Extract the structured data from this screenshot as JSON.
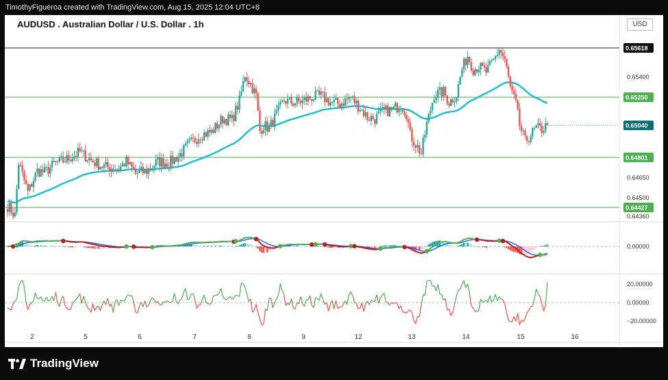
{
  "header": {
    "attribution": "TimothyFigueroa created with TradingView.com, Aug 15, 2025 12:04 UTC+8"
  },
  "chart_title": "AUDUSD . Australian Dollar / U.S. Dollar . 1h",
  "currency": "USD",
  "footer": {
    "logo_text": "TradingView"
  },
  "colors": {
    "bull": "#26a69a",
    "bear": "#ef5350",
    "ma": "#1fbdd2",
    "level": "#4caf50",
    "macd_fast": "#4caf50",
    "macd_slow": "#2962ff",
    "macd_signal": "#b71c1c",
    "osc": "#4caf50"
  },
  "chart_data": [
    {
      "type": "candlestick",
      "title": "AUDUSD . Australian Dollar / U.S. Dollar . 1h",
      "x_ticks": [
        "2",
        "5",
        "6",
        "7",
        "8",
        "9",
        "12",
        "13",
        "14",
        "15",
        "16"
      ],
      "ylim": [
        0.6432,
        0.6571
      ],
      "y_ticks": [
        0.654,
        0.6465,
        0.645,
        0.6436
      ],
      "horizontal_levels": [
        {
          "value": 0.65618,
          "label": "0.65618",
          "style": "black"
        },
        {
          "value": 0.6525,
          "label": "0.65250",
          "style": "green"
        },
        {
          "value": 0.64801,
          "label": "0.64801",
          "style": "green"
        },
        {
          "value": 0.64427,
          "label": "0.64427",
          "style": "green"
        }
      ],
      "last_price": {
        "value": 0.6504,
        "label": "0.65040"
      },
      "close_path": [
        [
          0,
          0.6444
        ],
        [
          4,
          0.6437
        ],
        [
          6,
          0.6476
        ],
        [
          11,
          0.6454
        ],
        [
          16,
          0.647
        ],
        [
          20,
          0.6469
        ],
        [
          26,
          0.6476
        ],
        [
          31,
          0.6478
        ],
        [
          39,
          0.6484
        ],
        [
          46,
          0.6477
        ],
        [
          52,
          0.6473
        ],
        [
          60,
          0.6472
        ],
        [
          64,
          0.6477
        ],
        [
          69,
          0.6468
        ],
        [
          75,
          0.647
        ],
        [
          81,
          0.6477
        ],
        [
          87,
          0.6476
        ],
        [
          92,
          0.6481
        ],
        [
          98,
          0.649
        ],
        [
          104,
          0.6497
        ],
        [
          110,
          0.6499
        ],
        [
          116,
          0.6509
        ],
        [
          121,
          0.6508
        ],
        [
          125,
          0.6522
        ],
        [
          128,
          0.6542
        ],
        [
          131,
          0.6535
        ],
        [
          134,
          0.6526
        ],
        [
          136,
          0.65
        ],
        [
          138,
          0.6504
        ],
        [
          141,
          0.6502
        ],
        [
          145,
          0.6512
        ],
        [
          149,
          0.6523
        ],
        [
          153,
          0.6521
        ],
        [
          159,
          0.6522
        ],
        [
          164,
          0.6525
        ],
        [
          169,
          0.6526
        ],
        [
          174,
          0.6521
        ],
        [
          179,
          0.652
        ],
        [
          185,
          0.6525
        ],
        [
          190,
          0.6517
        ],
        [
          194,
          0.651
        ],
        [
          198,
          0.6509
        ],
        [
          202,
          0.6514
        ],
        [
          208,
          0.6516
        ],
        [
          212,
          0.652
        ],
        [
          215,
          0.6513
        ],
        [
          217,
          0.6497
        ],
        [
          220,
          0.649
        ],
        [
          223,
          0.6483
        ],
        [
          226,
          0.6505
        ],
        [
          230,
          0.6527
        ],
        [
          235,
          0.6529
        ],
        [
          238,
          0.6521
        ],
        [
          242,
          0.6527
        ],
        [
          245,
          0.6546
        ],
        [
          248,
          0.6556
        ],
        [
          251,
          0.6546
        ],
        [
          254,
          0.6548
        ],
        [
          258,
          0.6544
        ],
        [
          262,
          0.6552
        ],
        [
          265,
          0.6561
        ],
        [
          268,
          0.6553
        ],
        [
          271,
          0.6532
        ],
        [
          274,
          0.652
        ],
        [
          276,
          0.6504
        ],
        [
          279,
          0.6492
        ],
        [
          282,
          0.6497
        ],
        [
          285,
          0.6502
        ],
        [
          288,
          0.6501
        ],
        [
          291,
          0.6504
        ]
      ],
      "bar_count": 292
    },
    {
      "type": "line",
      "series": [
        {
          "name": "",
          "values": []
        }
      ],
      "y_ticks": [
        0.0
      ]
    },
    {
      "type": "line",
      "series": [
        {
          "name": "",
          "values": []
        }
      ],
      "y_ticks": [
        20.0,
        0.0,
        -20.0
      ]
    }
  ]
}
